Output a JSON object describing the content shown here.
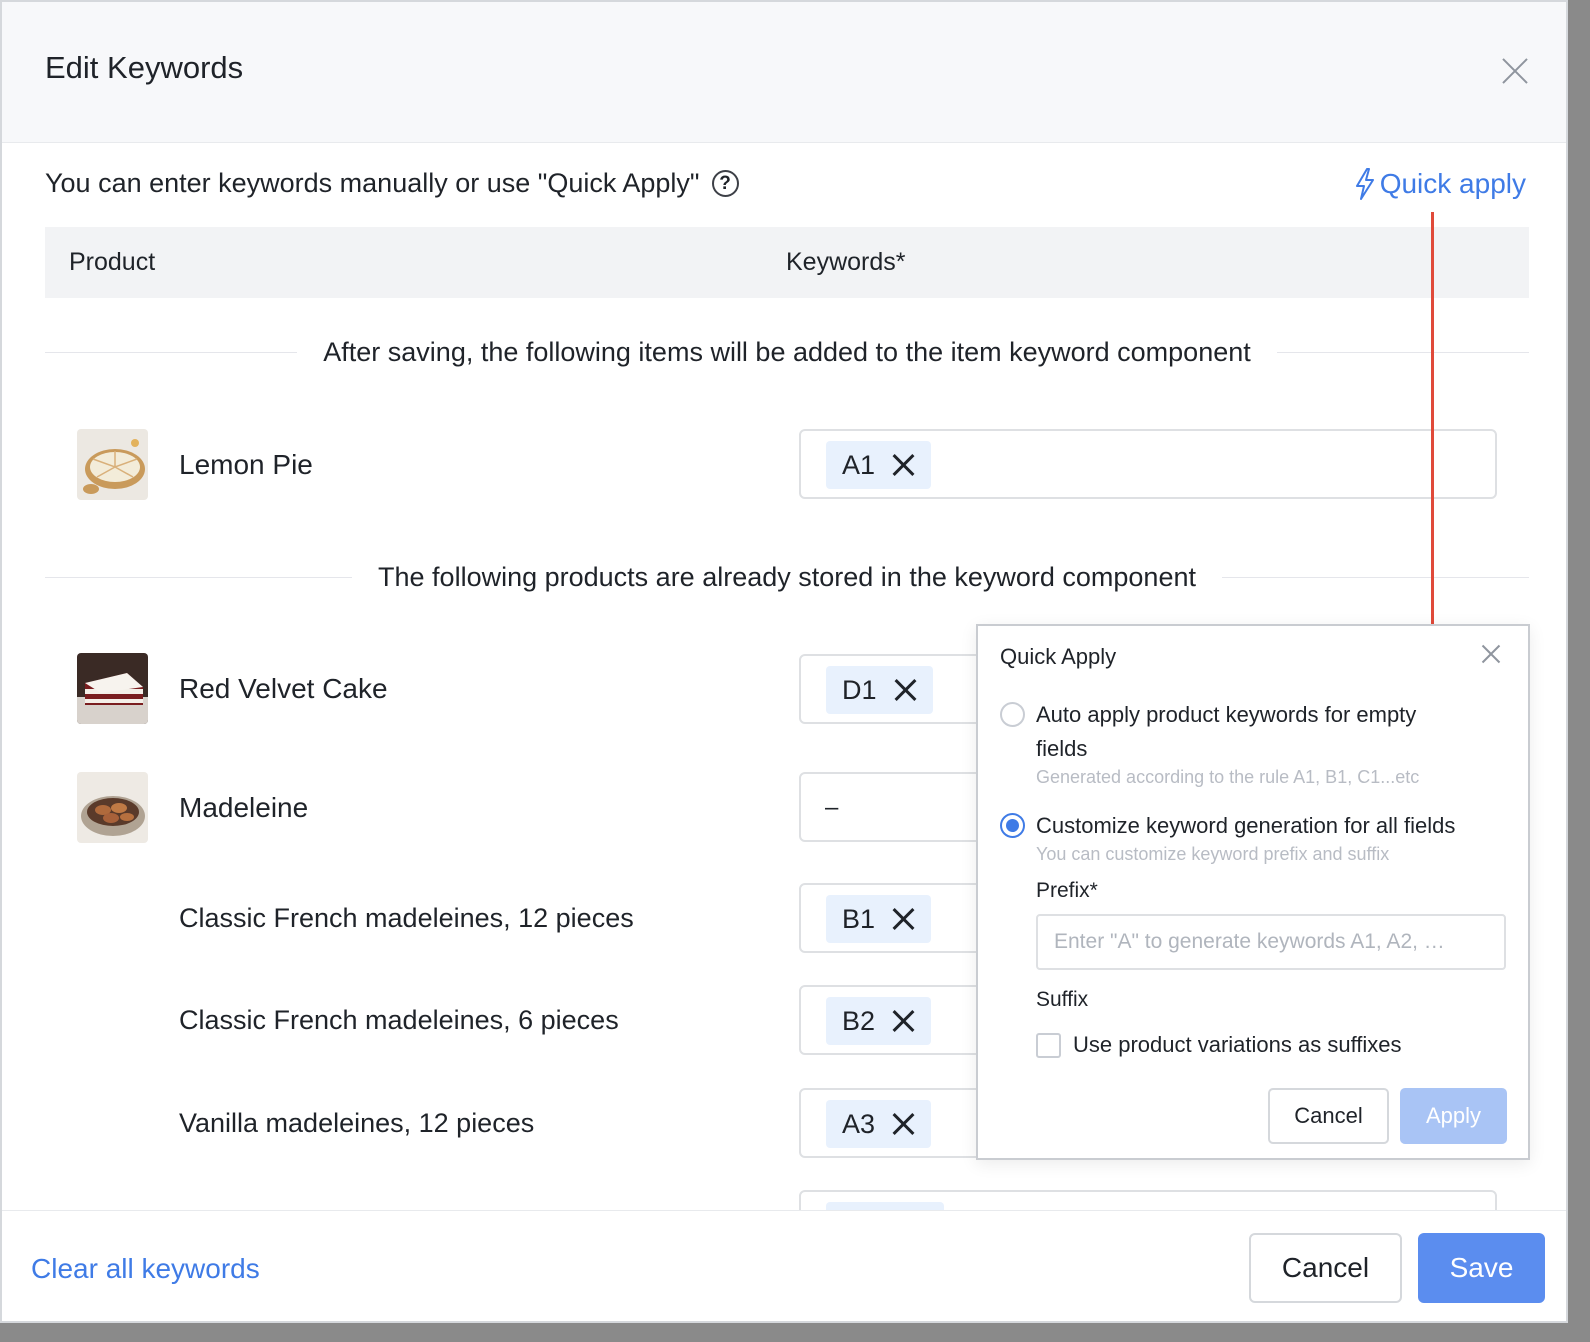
{
  "dialog": {
    "title": "Edit Keywords",
    "intro": "You can enter keywords manually or use \"Quick Apply\"",
    "help_glyph": "?",
    "quick_apply_link": "Quick apply"
  },
  "table": {
    "col_product": "Product",
    "col_keywords": "Keywords*"
  },
  "section_new": "After saving, the following items will be added to the item keyword component",
  "section_existing": "The following products are already stored in the keyword component",
  "products": {
    "lemon_pie": {
      "name": "Lemon Pie",
      "tag": "A1"
    },
    "red_velvet": {
      "name": "Red Velvet Cake",
      "tag": "D1"
    },
    "madeleine": {
      "name": "Madeleine",
      "placeholder_dash": "–"
    },
    "variants": [
      {
        "name": "Classic French madeleines, 12 pieces",
        "tag": "B1"
      },
      {
        "name": "Classic French madeleines, 6 pieces",
        "tag": "B2"
      },
      {
        "name": "Vanilla madeleines, 12 pieces",
        "tag": "A3"
      }
    ]
  },
  "footer": {
    "clear_all": "Clear all keywords",
    "cancel": "Cancel",
    "save": "Save"
  },
  "quick_apply": {
    "title": "Quick Apply",
    "option_auto": {
      "label": "Auto apply product keywords for empty fields",
      "hint": "Generated according to the rule A1, B1, C1...etc",
      "selected": false
    },
    "option_custom": {
      "label": "Customize keyword generation for all fields",
      "hint": "You can customize keyword prefix and suffix",
      "selected": true
    },
    "prefix_label": "Prefix*",
    "prefix_placeholder": "Enter \"A\" to generate keywords A1, A2, …",
    "prefix_value": "",
    "suffix_label": "Suffix",
    "suffix_checkbox": "Use product variations as suffixes",
    "cancel": "Cancel",
    "apply": "Apply"
  },
  "colors": {
    "accent": "#3f7be6",
    "save_bg": "#5b8def",
    "apply_disabled_bg": "#a9c4f5",
    "tag_bg": "#e8f1fd",
    "annotation_arrow": "#e04a3a"
  }
}
